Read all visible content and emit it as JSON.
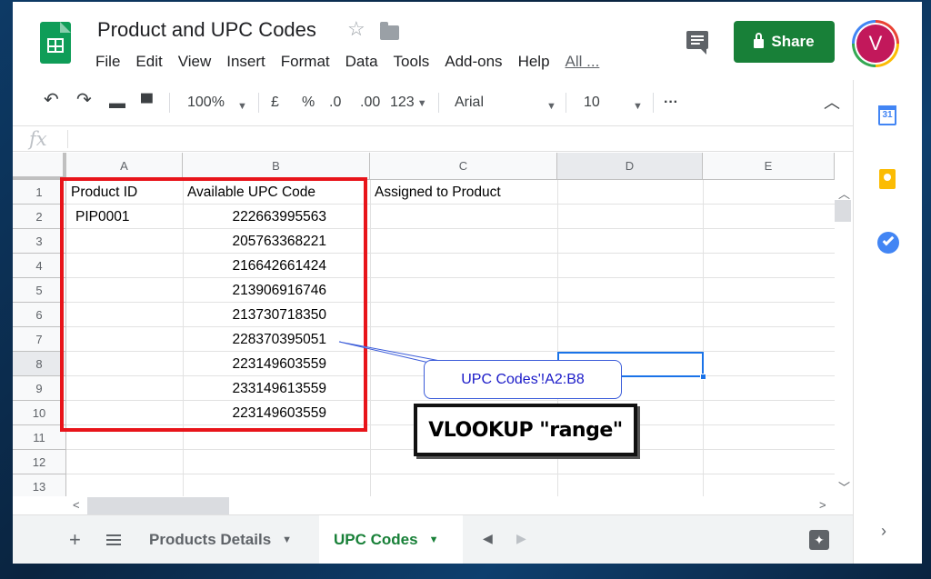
{
  "doc": {
    "title": "Product and UPC Codes",
    "share_label": "Share",
    "avatar_initial": "V"
  },
  "menu": [
    "File",
    "Edit",
    "View",
    "Insert",
    "Format",
    "Data",
    "Tools",
    "Add-ons",
    "Help",
    "All ..."
  ],
  "toolbar": {
    "zoom": "100%",
    "currency": "£",
    "percent": "%",
    "decrease_decimal": ".0",
    "increase_decimal": ".00",
    "more_formats": "123",
    "font": "Arial",
    "font_size": "10",
    "more": "···"
  },
  "formula_bar": {
    "fx": "fx",
    "value": ""
  },
  "columns": [
    "A",
    "B",
    "C",
    "D",
    "E"
  ],
  "rows": [
    "1",
    "2",
    "3",
    "4",
    "5",
    "6",
    "7",
    "8",
    "9",
    "10",
    "11",
    "12",
    "13"
  ],
  "cells": {
    "A1": "Product ID",
    "B1": "Available UPC Code",
    "C1": "Assigned to Product",
    "A2": "PIP0001",
    "B2": "222663995563",
    "B3": "205763368221",
    "B4": "216642661424",
    "B5": "213906916746",
    "B6": "213730718350",
    "B7": "228370395051",
    "B8": "223149603559",
    "B9": "233149613559",
    "B10": "223149603559"
  },
  "sheets": {
    "inactive": "Products Details",
    "active": "UPC Codes"
  },
  "annotations": {
    "callout": "UPC Codes'!A2:B8",
    "label": "VLOOKUP \"range\"",
    "highlight_color": "#e8141a"
  },
  "side_panel": {
    "calendar_day": "31"
  },
  "colors": {
    "brand_green": "#188038",
    "selection_blue": "#1a73e8"
  }
}
